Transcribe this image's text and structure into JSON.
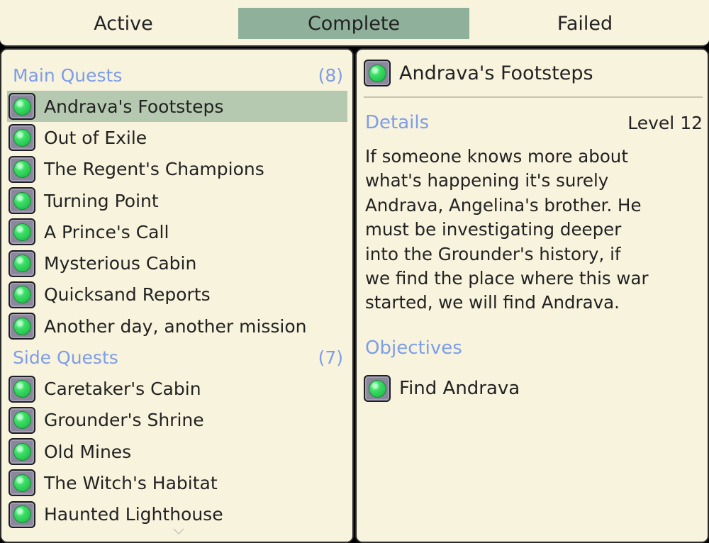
{
  "tabs": {
    "active": "Active",
    "complete": "Complete",
    "failed": "Failed",
    "selected": "Complete"
  },
  "main_quests": {
    "title": "Main Quests",
    "count": "(8)",
    "items": [
      "Andrava's Footsteps",
      "Out of Exile",
      "The Regent's Champions",
      "Turning Point",
      "A Prince's Call",
      "Mysterious Cabin",
      "Quicksand Reports",
      "Another day, another mission"
    ],
    "selected_index": 0
  },
  "side_quests": {
    "title": "Side Quests",
    "count": "(7)",
    "items": [
      "Caretaker's Cabin",
      "Grounder's Shrine",
      "Old Mines",
      "The Witch's Habitat",
      "Haunted Lighthouse"
    ]
  },
  "detail": {
    "title": "Andrava's Footsteps",
    "details_heading": "Details",
    "level": "Level 12",
    "description_lines": [
      "If someone knows more about",
      "what's happening it's surely",
      "Andrava, Angelina's brother. He",
      "must be investigating deeper",
      "into the Grounder's history, if",
      "we find the place where this war",
      "started, we will find Andrava."
    ],
    "objectives_heading": "Objectives",
    "objectives": [
      "Find Andrava"
    ]
  },
  "icons": {
    "status": "quest-complete-icon",
    "scroll": "chevron-down-icon"
  },
  "colors": {
    "panel_bg": "#f8f3dd",
    "selected_tab": "#8fb09b",
    "selected_row": "#b5c8b0",
    "heading_blue": "#7d9de6",
    "icon_green": "#3fe06a",
    "icon_frame": "#8a869b"
  }
}
